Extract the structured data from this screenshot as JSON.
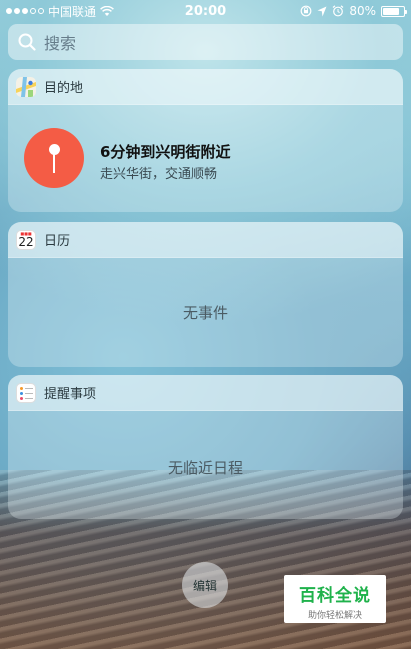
{
  "status_bar": {
    "carrier": "中国联通",
    "time": "20:00",
    "battery": "80%",
    "battery_level": 0.8,
    "icons": [
      "signal-dots",
      "wifi-icon",
      "rotation-lock-icon",
      "location-icon",
      "alarm-icon",
      "battery-icon"
    ]
  },
  "search": {
    "placeholder": "搜索",
    "icon": "search-icon"
  },
  "widgets": {
    "destination": {
      "title": "目的地",
      "icon": "maps-app-icon",
      "route_title": "6分钟到兴明街附近",
      "route_subtitle": "走兴华街，交通顺畅",
      "accent": "#f45c45"
    },
    "calendar": {
      "title": "日历",
      "icon": "calendar-app-icon",
      "icon_day": "22",
      "empty": "无事件"
    },
    "reminders": {
      "title": "提醒事项",
      "icon": "reminders-app-icon",
      "empty": "无临近日程"
    }
  },
  "edit_button": {
    "label": "编辑"
  },
  "watermark": {
    "main": "百科全说",
    "sub": "助你轻松解决",
    "color": "#1fb24b"
  }
}
